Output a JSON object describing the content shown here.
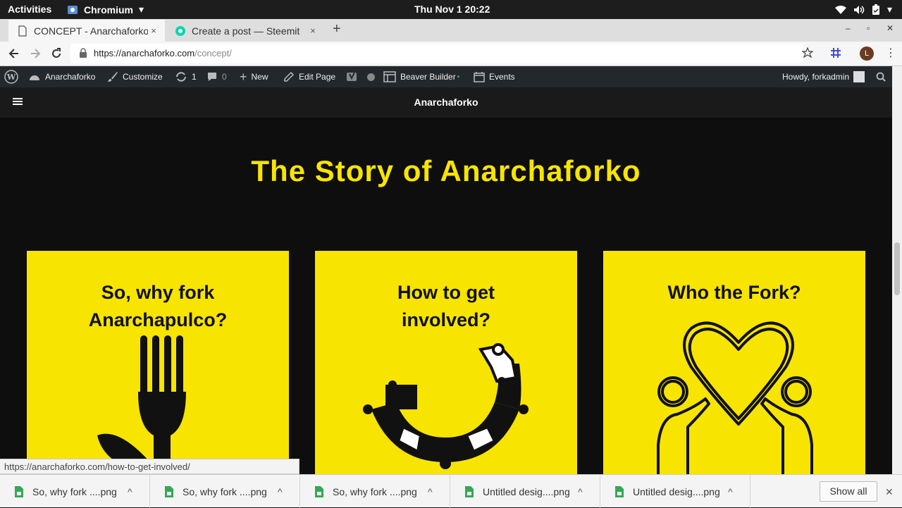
{
  "gnome": {
    "activities": "Activities",
    "app_name": "Chromium",
    "clock": "Thu Nov 1  20:22"
  },
  "tabs": [
    {
      "title": "CONCEPT - Anarchaforko",
      "close": "×"
    },
    {
      "title": "Create a post — Steemit",
      "close": "×"
    }
  ],
  "new_tab": "+",
  "window_controls": {
    "minimize": "–",
    "maximize": "▫",
    "close": "✕"
  },
  "omnibox": {
    "url_host": "https://anarchaforko.com",
    "url_path": "/concept/"
  },
  "profile_initial": "L",
  "adminbar": {
    "site": "Anarchaforko",
    "customize": "Customize",
    "updates": "1",
    "comments": "0",
    "new": "New",
    "edit_page": "Edit Page",
    "beaver": "Beaver Builder",
    "events": "Events",
    "howdy": "Howdy, forkadmin"
  },
  "site_header": {
    "brand": "Anarchaforko"
  },
  "page": {
    "title": "The Story of Anarchaforko",
    "cards": [
      {
        "line1": "So, why fork",
        "line2": "Anarchapulco?",
        "art": "fork-icon"
      },
      {
        "line1": "How to get",
        "line2": "involved?",
        "art": "puzzle-icon"
      },
      {
        "line1": "Who the Fork?",
        "line2": "",
        "art": "heart-people-icon"
      }
    ]
  },
  "status_url": "https://anarchaforko.com/how-to-get-involved/",
  "downloads": [
    {
      "name": "So, why fork ....png"
    },
    {
      "name": "So, why fork ....png"
    },
    {
      "name": "So, why fork ....png"
    },
    {
      "name": "Untitled desig....png"
    },
    {
      "name": "Untitled desig....png"
    }
  ],
  "show_all": "Show all",
  "colors": {
    "brand_yellow": "#f7e400",
    "page_bg": "#0e0e0e",
    "adminbar_bg": "#23282d"
  }
}
